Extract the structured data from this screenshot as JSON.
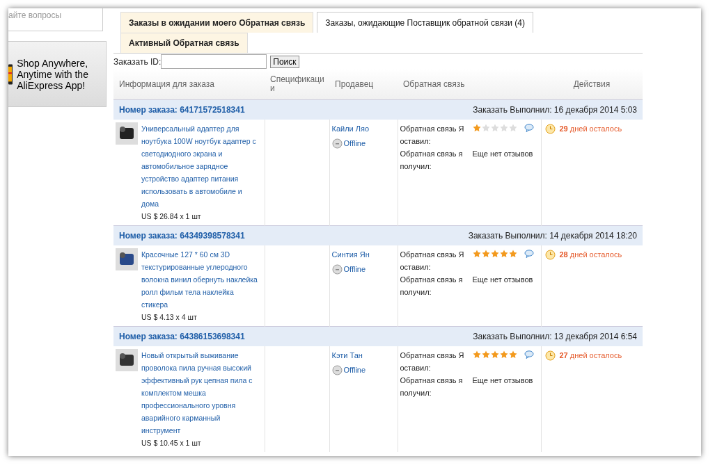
{
  "sidebar": {
    "question_box": "айте вопросы",
    "promo": "Shop Anywhere, Anytime with the AliExpress App!"
  },
  "tabs": [
    {
      "label": "Заказы в ожидании моего Обратная связь",
      "selected": false
    },
    {
      "label": "Заказы, ожидающие Поставщик обратной связи (4)",
      "selected": true
    },
    {
      "label": "Активный Обратная связь",
      "selected": false
    }
  ],
  "search": {
    "label": "Заказать ID:",
    "button": "Поиск"
  },
  "table": {
    "columns": [
      "Информация для заказа",
      "Спецификаци и",
      "Продавец",
      "Обратная связь",
      "Действия"
    ],
    "orders": [
      {
        "number": "Номер заказа: 64171572518341",
        "completed": "Заказать Выполнил: 16 декабря 2014 5:03",
        "product": "Универсальный адаптер для ноутбука 100W ноутбук адаптер с светодиодного экрана и автомобильное зарядное устройство адаптер питания использовать в автомобиле и дома",
        "price": "US $ 26.84 x 1 шт",
        "seller": "Кайли Ляо",
        "status": "Offline",
        "left_label": "Обратная связь Я оставил:",
        "stars": 1,
        "received_label": "Обратная связь я получил:",
        "received": "Еще нет отзывов",
        "remaining": "**29** дней осталось"
      },
      {
        "number": "Номер заказа: 64349398578341",
        "completed": "Заказать Выполнил: 14 декабря 2014 18:20",
        "product": "Красочные 127 * 60 см 3D текстурированные углеродного волокна винил обернуть наклейка ролл фильм тела наклейка стикера",
        "price": "US $ 4.13 x 4 шт",
        "seller": "Синтия Ян",
        "status": "Offline",
        "left_label": "Обратная связь Я оставил:",
        "stars": 5,
        "received_label": "Обратная связь я получил:",
        "received": "Еще нет отзывов",
        "remaining": "**28** дней осталось"
      },
      {
        "number": "Номер заказа: 64386153698341",
        "completed": "Заказать Выполнил: 13 декабря 2014 6:54",
        "product": "Новый открытый выживание проволока пила ручная высокий эффективный рук цепная пила с комплектом мешка профессионального уровня аварийного карманный инструмент",
        "price": "US $ 10.45 x 1 шт",
        "seller": "Кэти Тан",
        "status": "Offline",
        "left_label": "Обратная связь Я оставил:",
        "stars": 5,
        "received_label": "Обратная связь я получил:",
        "received": "Еще нет отзывов",
        "remaining": "**27** дней осталось"
      }
    ]
  }
}
